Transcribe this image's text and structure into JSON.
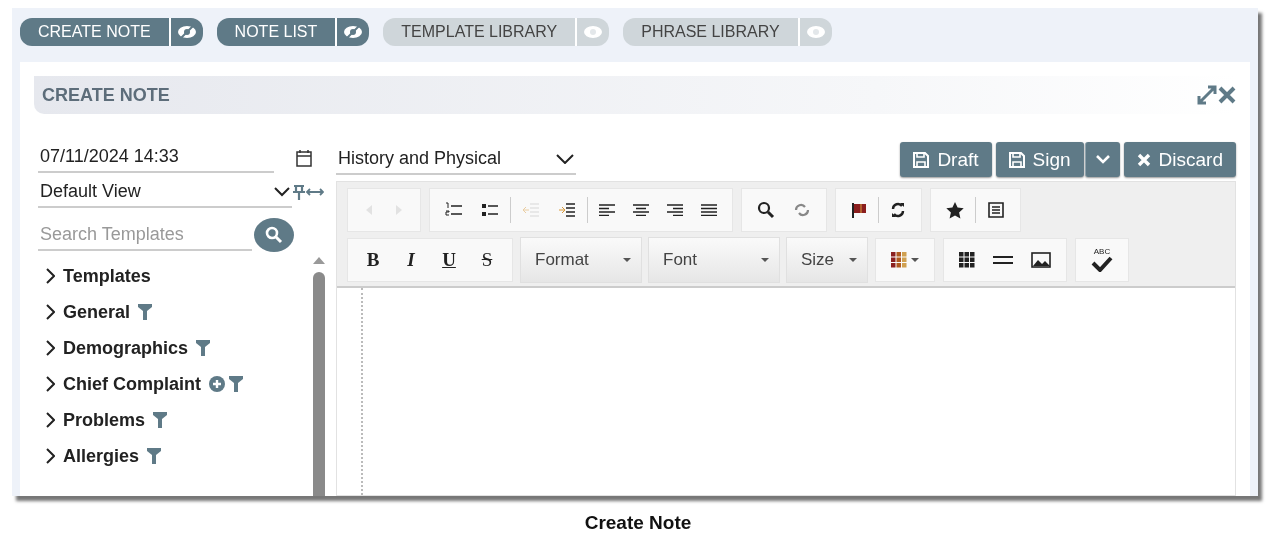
{
  "tabs": [
    {
      "label": "CREATE NOTE",
      "active": true
    },
    {
      "label": "NOTE LIST",
      "active": true
    },
    {
      "label": "TEMPLATE LIBRARY",
      "active": false
    },
    {
      "label": "PHRASE LIBRARY",
      "active": false
    }
  ],
  "panel": {
    "title": "CREATE NOTE"
  },
  "date_field": {
    "value": "07/11/2024 14:33"
  },
  "view_select": {
    "value": "Default View"
  },
  "search": {
    "placeholder": "Search Templates"
  },
  "tree": [
    {
      "label": "Templates",
      "filter": false,
      "add": false
    },
    {
      "label": "General",
      "filter": true,
      "add": false
    },
    {
      "label": "Demographics",
      "filter": true,
      "add": false
    },
    {
      "label": "Chief Complaint",
      "filter": true,
      "add": true
    },
    {
      "label": "Problems",
      "filter": true,
      "add": false
    },
    {
      "label": "Allergies",
      "filter": true,
      "add": false
    }
  ],
  "note_type": {
    "value": "History and Physical"
  },
  "actions": [
    {
      "label": "Draft",
      "kind": "save"
    },
    {
      "label": "Sign",
      "kind": "save"
    },
    {
      "kind": "caret"
    },
    {
      "label": "Discard",
      "kind": "discard"
    }
  ],
  "toolbar_row_1": [
    [
      {
        "kind": "undo",
        "disabled": true
      },
      {
        "kind": "redo",
        "disabled": true
      }
    ],
    [
      {
        "kind": "numbered-list",
        "disabled": false
      },
      {
        "kind": "bullet-list",
        "disabled": false
      },
      {
        "kind": "sep"
      },
      {
        "kind": "outdent",
        "disabled": true
      },
      {
        "kind": "indent",
        "disabled": false
      },
      {
        "kind": "sep"
      },
      {
        "kind": "align-left",
        "disabled": false
      },
      {
        "kind": "align-center",
        "disabled": false
      },
      {
        "kind": "align-right",
        "disabled": false
      },
      {
        "kind": "justify",
        "disabled": false
      }
    ],
    [
      {
        "kind": "find",
        "disabled": false
      },
      {
        "kind": "replace",
        "disabled": false
      }
    ],
    [
      {
        "kind": "flag",
        "disabled": false
      },
      {
        "kind": "sep"
      },
      {
        "kind": "refresh",
        "disabled": false
      }
    ],
    [
      {
        "kind": "star",
        "disabled": false
      },
      {
        "kind": "sep"
      },
      {
        "kind": "template",
        "disabled": false
      }
    ]
  ],
  "format_buttons": [
    {
      "label": "B",
      "kind": "bold"
    },
    {
      "label": "I",
      "kind": "italic"
    },
    {
      "label": "U",
      "kind": "underline"
    },
    {
      "label": "S",
      "kind": "strike"
    }
  ],
  "dropdowns": [
    "Format",
    "Font",
    "Size"
  ],
  "spellcheck_label": "ABC",
  "caption": "Create Note"
}
